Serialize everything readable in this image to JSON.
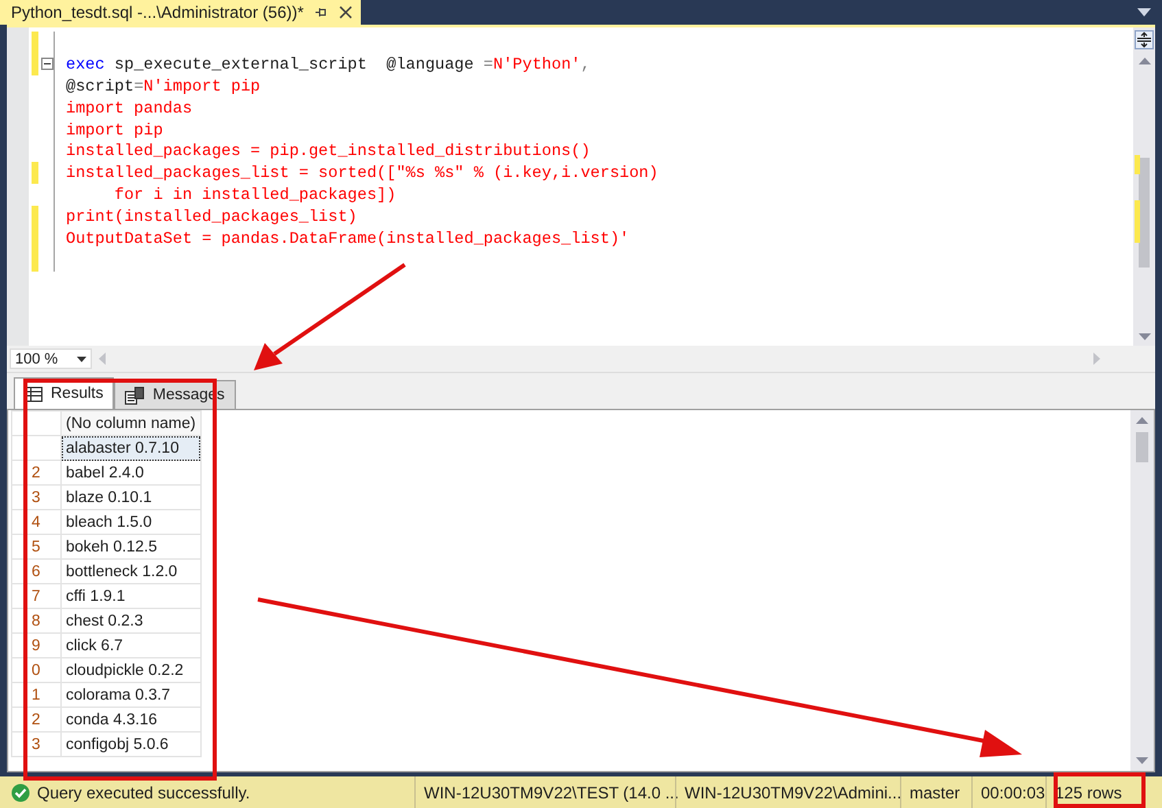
{
  "editor_tab": {
    "title": "Python_tesdt.sql -...\\Administrator (56))*",
    "selected": true
  },
  "code_lines": [
    {
      "changed": true
    },
    {
      "changed": true,
      "foldable": true,
      "segments": [
        {
          "kind": "keyword",
          "text": "exec"
        },
        {
          "kind": "plain",
          "text": " sp_execute_external_script  @language "
        },
        {
          "kind": "operator",
          "text": "="
        },
        {
          "kind": "string",
          "text": "N'Python'"
        },
        {
          "kind": "operator",
          "text": ","
        }
      ]
    },
    {
      "changed": false,
      "segments": [
        {
          "kind": "plain",
          "text": "@script"
        },
        {
          "kind": "operator",
          "text": "="
        },
        {
          "kind": "string",
          "text": "N'import pip"
        }
      ]
    },
    {
      "changed": false,
      "segments": [
        {
          "kind": "string",
          "text": "import pandas"
        }
      ]
    },
    {
      "changed": false,
      "segments": [
        {
          "kind": "string",
          "text": "import pip"
        }
      ]
    },
    {
      "changed": false,
      "segments": [
        {
          "kind": "string",
          "text": "installed_packages = pip.get_installed_distributions()"
        }
      ]
    },
    {
      "changed": true,
      "segments": [
        {
          "kind": "string",
          "text": "installed_packages_list = sorted([\"%s %s\" % (i.key,i.version)"
        }
      ]
    },
    {
      "changed": false,
      "segments": [
        {
          "kind": "string",
          "text": "     for i in installed_packages])"
        }
      ]
    },
    {
      "changed": true,
      "segments": [
        {
          "kind": "string",
          "text": "print(installed_packages_list)"
        }
      ]
    },
    {
      "changed": true,
      "segments": [
        {
          "kind": "string",
          "text": "OutputDataSet = pandas.DataFrame(installed_packages_list)'"
        }
      ]
    },
    {
      "changed": true
    }
  ],
  "zoom": {
    "value": "100 %"
  },
  "result_tabs": [
    {
      "label": "Results",
      "selected": true,
      "kind": "grid"
    },
    {
      "label": "Messages",
      "selected": false,
      "kind": "messages"
    }
  ],
  "results_grid": {
    "columns": [
      "(No column name)"
    ],
    "rows": [
      {
        "value": "alabaster 0.7.10",
        "selected": true
      },
      {
        "row_number": "2",
        "value": "babel 2.4.0",
        "selected": false
      },
      {
        "row_number": "3",
        "value": "blaze 0.10.1",
        "selected": false
      },
      {
        "row_number": "4",
        "value": "bleach 1.5.0",
        "selected": false
      },
      {
        "row_number": "5",
        "value": "bokeh 0.12.5",
        "selected": false
      },
      {
        "row_number": "6",
        "value": "bottleneck 1.2.0",
        "selected": false
      },
      {
        "row_number": "7",
        "value": "cffi 1.9.1",
        "selected": false
      },
      {
        "row_number": "8",
        "value": "chest 0.2.3",
        "selected": false
      },
      {
        "row_number": "9",
        "value": "click 6.7",
        "selected": false
      },
      {
        "row_number": "0",
        "value": "cloudpickle 0.2.2",
        "selected": false
      },
      {
        "row_number": "1",
        "value": "colorama 0.3.7",
        "selected": false
      },
      {
        "row_number": "2",
        "value": "conda 4.3.16",
        "selected": false
      },
      {
        "row_number": "3",
        "value": "configobj 5.0.6",
        "selected": false
      }
    ]
  },
  "status_bar": {
    "message": "Query executed successfully.",
    "cells": [
      "WIN-12U30TM9V22\\TEST (14.0 ...",
      "WIN-12U30TM9V22\\Admini...",
      "master",
      "00:00:03",
      "125 rows"
    ]
  }
}
